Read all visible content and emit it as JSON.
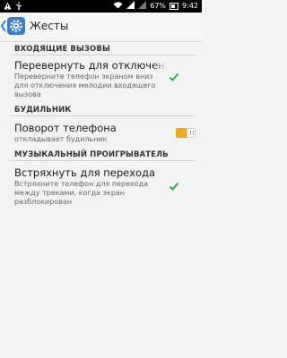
{
  "status_bar": {
    "battery": "67%",
    "time": "9:42",
    "icons": [
      "warning-icon",
      "usb-icon",
      "wifi-icon",
      "signal-icon",
      "signal-icon",
      "battery-icon"
    ]
  },
  "action_bar": {
    "title": "Жесты",
    "icon": "settings-gear-icon"
  },
  "sections": [
    {
      "header": "ВХОДЯЩИЕ ВЫЗОВЫ",
      "item": {
        "title": "Перевернуть для отключения",
        "subtitle": [
          "Переверните телефон экраном вниз",
          "для отключения мелодии входящего",
          "вызова"
        ],
        "control": "checkbox",
        "checked": true
      }
    },
    {
      "header": "БУДИЛЬНИК",
      "item": {
        "title": "Поворот телефона",
        "subtitle": [
          "откладывает будильник"
        ],
        "control": "toggle",
        "on": true
      }
    },
    {
      "header": "МУЗЫКАЛЬНЫЙ ПРОИГРЫВАТЕЛЬ",
      "item": {
        "title": "Встряхнуть для перехода",
        "subtitle": [
          "Встряхните телефон для перехода",
          "между треками, когда экран",
          "разблокирован"
        ],
        "control": "checkbox",
        "checked": true
      }
    }
  ],
  "colors": {
    "accent": "#f2a81a",
    "check": "#3aa844",
    "app_icon": "#3c7ec7"
  }
}
